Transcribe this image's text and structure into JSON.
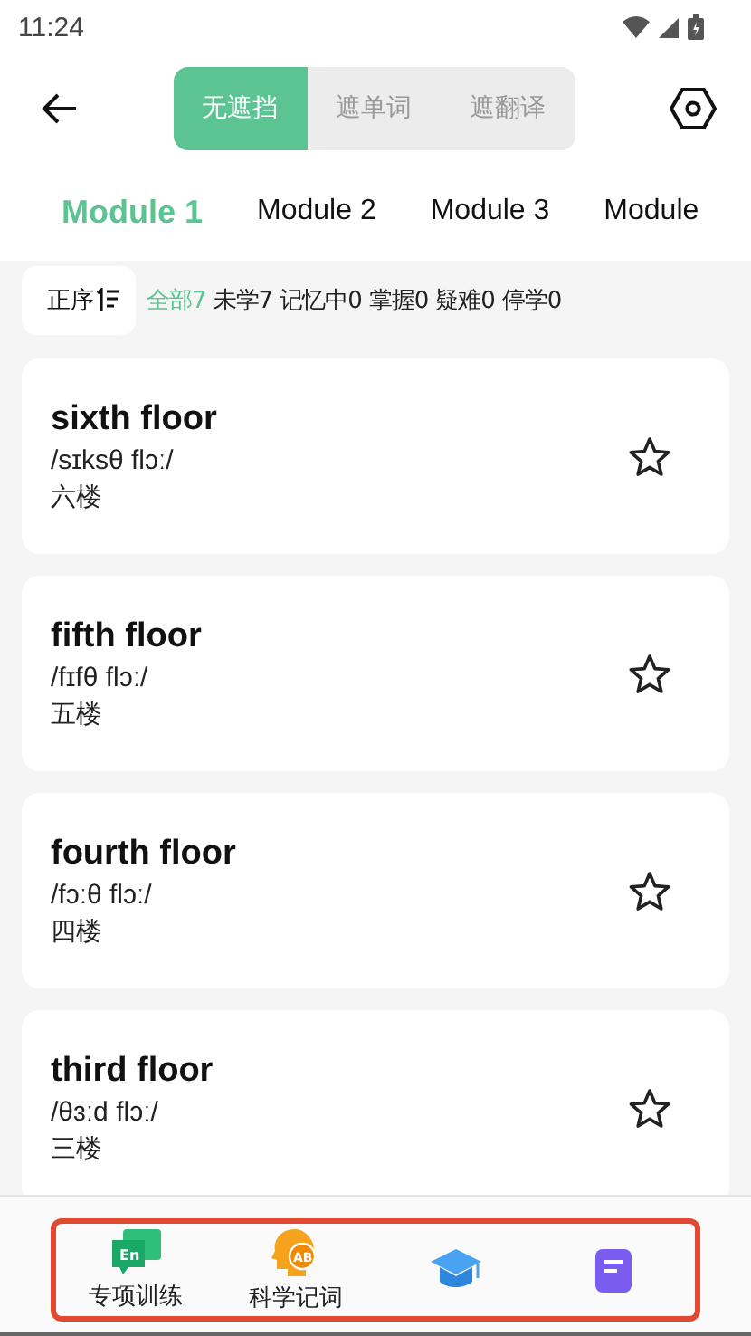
{
  "status_bar": {
    "time": "11:24"
  },
  "mask_modes": [
    {
      "label": "无遮挡",
      "selected": true
    },
    {
      "label": "遮单词",
      "selected": false
    },
    {
      "label": "遮翻译",
      "selected": false
    }
  ],
  "modules": [
    {
      "label": "Module 1",
      "selected": true
    },
    {
      "label": "Module 2",
      "selected": false
    },
    {
      "label": "Module 3",
      "selected": false
    },
    {
      "label": "Module",
      "selected": false
    }
  ],
  "sort": {
    "label": "正序"
  },
  "filters": [
    {
      "label": "全部7",
      "selected": true
    },
    {
      "label": "未学7",
      "selected": false
    },
    {
      "label": "记忆中0",
      "selected": false
    },
    {
      "label": "掌握0",
      "selected": false
    },
    {
      "label": "疑难0",
      "selected": false
    },
    {
      "label": "停学0",
      "selected": false
    }
  ],
  "words": [
    {
      "word": "sixth floor",
      "phonetic": "/sɪksθ flɔː/",
      "meaning": "六楼",
      "starred": false
    },
    {
      "word": "fifth floor",
      "phonetic": "/fɪfθ flɔː/",
      "meaning": "五楼",
      "starred": false
    },
    {
      "word": "fourth floor",
      "phonetic": "/fɔːθ flɔː/",
      "meaning": "四楼",
      "starred": false
    },
    {
      "word": "third floor",
      "phonetic": "/θɜːd flɔː/",
      "meaning": "三楼",
      "starred": false
    }
  ],
  "bottom_nav": [
    {
      "kind": "chat",
      "icon_text": "En",
      "label": "专项训练"
    },
    {
      "kind": "head",
      "icon_text": "AB",
      "label": "科学记词"
    },
    {
      "kind": "cap"
    },
    {
      "kind": "doc"
    }
  ]
}
